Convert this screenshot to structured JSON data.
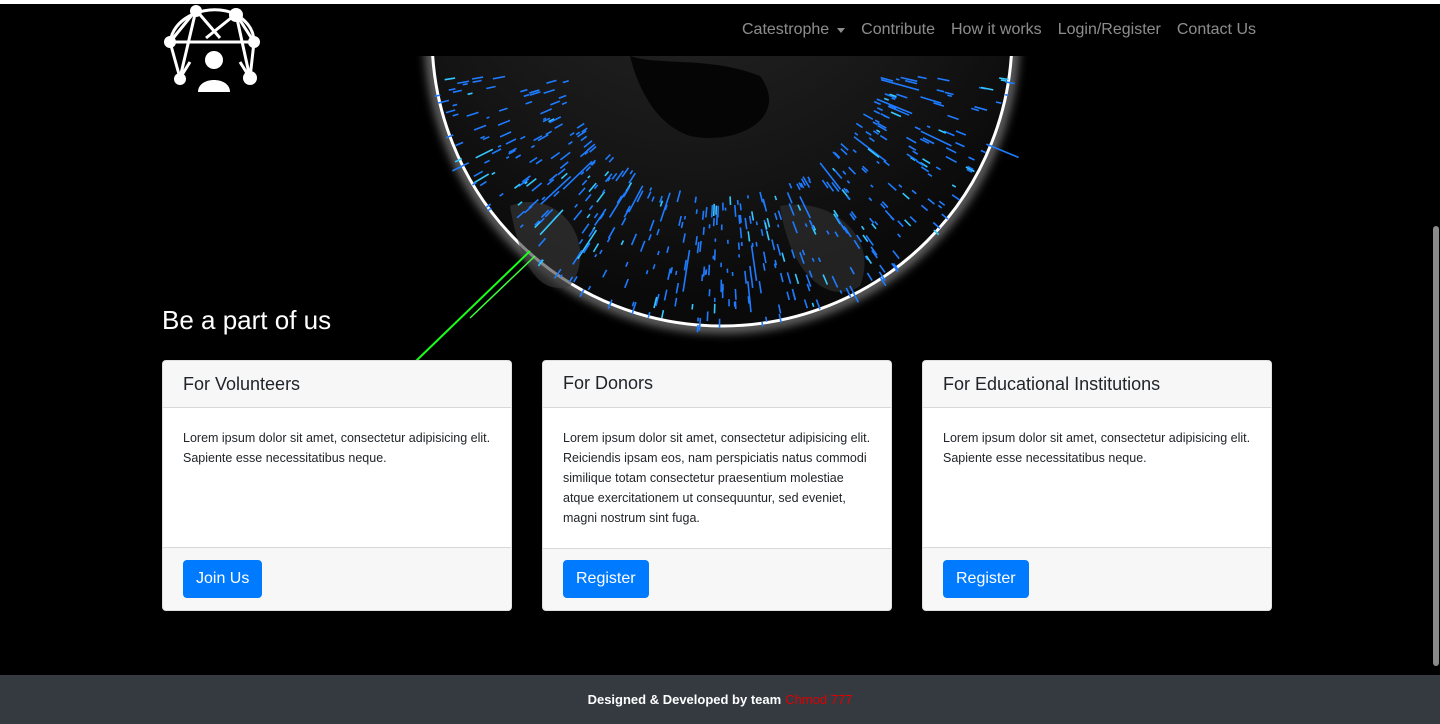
{
  "nav": {
    "items": [
      {
        "label": "Catestrophe",
        "dropdown": true
      },
      {
        "label": "Contribute"
      },
      {
        "label": "How it works"
      },
      {
        "label": "Login/Register"
      },
      {
        "label": "Contact Us"
      }
    ]
  },
  "logo": {
    "icon": "network-people-logo-icon"
  },
  "section": {
    "title": "Be a part of us"
  },
  "cards": [
    {
      "title": "For Volunteers",
      "text": "Lorem ipsum dolor sit amet, consectetur adipisicing elit. Sapiente esse necessitatibus neque.",
      "button": "Join Us"
    },
    {
      "title": "For Donors",
      "text": "Lorem ipsum dolor sit amet, consectetur adipisicing elit. Reiciendis ipsam eos, nam perspiciatis natus commodi similique totam consectetur praesentium molestiae atque exercitationem ut consequuntur, sed eveniet, magni nostrum sint fuga.",
      "button": "Register"
    },
    {
      "title": "For Educational Institutions",
      "text": "Lorem ipsum dolor sit amet, consectetur adipisicing elit. Sapiente esse necessitatibus neque.",
      "button": "Register"
    }
  ],
  "footer": {
    "text": "Designed & Developed by team",
    "team": "Chmod 777"
  },
  "colors": {
    "primary": "#007bff",
    "footer_bg": "#343a40",
    "team_red": "#e00000",
    "globe_spikes": "#1e7bff"
  }
}
